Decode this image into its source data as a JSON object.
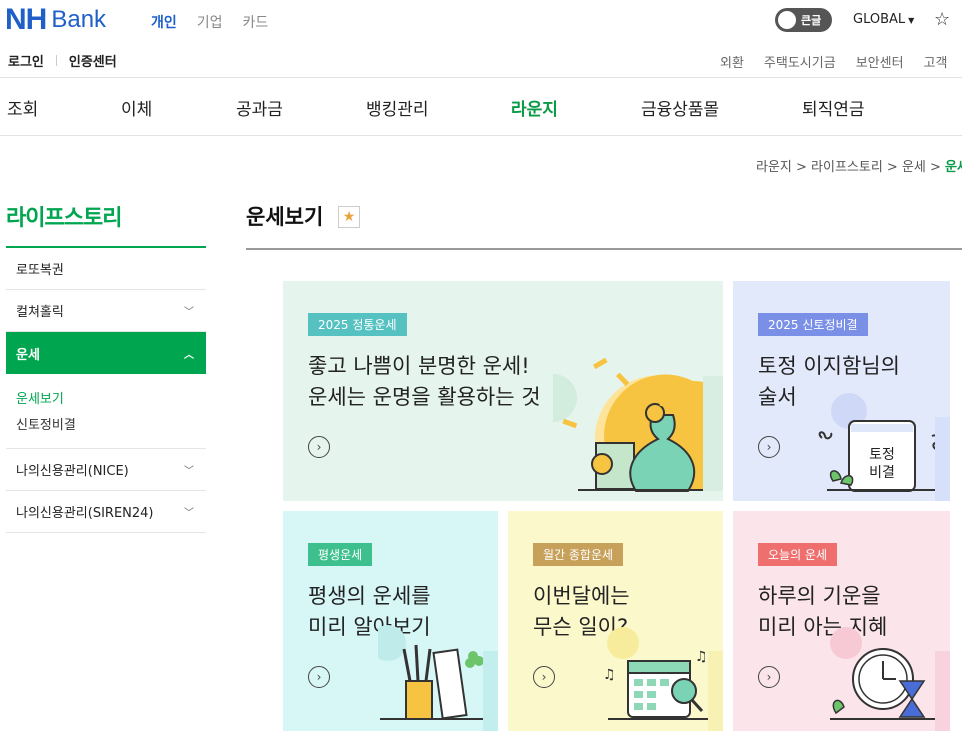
{
  "brand": {
    "nh": "NH",
    "bank": "Bank"
  },
  "segments": [
    "개인",
    "기업",
    "카드"
  ],
  "toggle_label": "큰글",
  "global_label": "GLOBAL",
  "util_left": [
    "로그인",
    "인증센터"
  ],
  "util_right": [
    "외환",
    "주택도시기금",
    "보안센터",
    "고객"
  ],
  "nav": [
    "조회",
    "이체",
    "공과금",
    "뱅킹관리",
    "라운지",
    "금융상품몰",
    "퇴직연금"
  ],
  "breadcrumb": {
    "path": "라운지 > 라이프스토리 > 운세 > ",
    "current": "운세"
  },
  "sidebar": {
    "title": "라이프스토리",
    "items": [
      {
        "label": "로또복권"
      },
      {
        "label": "컬쳐홀릭"
      },
      {
        "label": "운세"
      },
      {
        "label": "나의신용관리(NICE)"
      },
      {
        "label": "나의신용관리(SIREN24)"
      }
    ],
    "sub": [
      "운세보기",
      "신토정비결"
    ]
  },
  "page_title": "운세보기",
  "cards": [
    {
      "badge": "2025 정통운세",
      "text": "좋고 나쁨이 분명한 운세!\n운세는 운명을 활용하는 것",
      "bg": "#e6f4ee",
      "badge_color": "#56c1c1"
    },
    {
      "badge": "2025 신토정비결",
      "text": "토정 이지함님의\n술서",
      "bg": "#e2e9fb",
      "badge_color": "#7a8fe6",
      "book_text": "토정\n비결"
    },
    {
      "badge": "평생운세",
      "text": "평생의 운세를\n미리 알아보기",
      "bg": "#d7f6f6",
      "badge_color": "#3ec08e"
    },
    {
      "badge": "월간 종합운세",
      "text": "이번달에는\n무슨 일이?",
      "bg": "#fbf8cc",
      "badge_color": "#c7a05a"
    },
    {
      "badge": "오늘의 운세",
      "text": "하루의 기운을\n미리 아는 지혜",
      "bg": "#fbe4ea",
      "badge_color": "#ef6f6f"
    }
  ],
  "colors": {
    "brand_blue": "#1e60c8",
    "accent_green": "#00a54f"
  }
}
